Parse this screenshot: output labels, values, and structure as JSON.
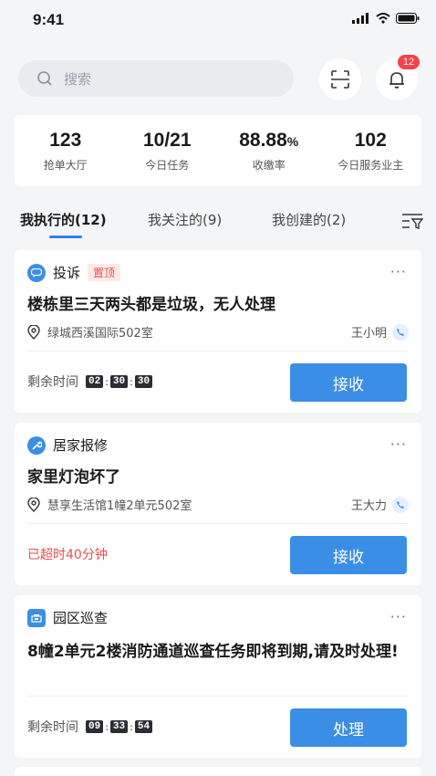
{
  "status_bar": {
    "time": "9:41"
  },
  "search": {
    "placeholder": "搜索"
  },
  "notifications": {
    "count": "12"
  },
  "stats": [
    {
      "value": "123",
      "unit": "",
      "label": "抢单大厅"
    },
    {
      "value": "10/21",
      "unit": "",
      "label": "今日任务"
    },
    {
      "value": "88.88",
      "unit": "%",
      "label": "收缴率"
    },
    {
      "value": "102",
      "unit": "",
      "label": "今日服务业主"
    }
  ],
  "tabs": [
    {
      "label": "我执行的(12)",
      "active": true
    },
    {
      "label": "我关注的(9)",
      "active": false
    },
    {
      "label": "我创建的(2)",
      "active": false
    }
  ],
  "cards": [
    {
      "type": "投诉",
      "tag": "置顶",
      "more": "···",
      "title": "楼栋里三天两头都是垃圾，无人处理",
      "address": "绿城西溪国际502室",
      "person": "王小明",
      "status_label": "剩余时间",
      "timer": [
        "02",
        "30",
        "30"
      ],
      "action": "接收"
    },
    {
      "type": "居家报修",
      "more": "···",
      "title": "家里灯泡坏了",
      "address": "慧享生活馆1幢2单元502室",
      "person": "王大力",
      "status_label": "已超时40分钟",
      "action": "接收"
    },
    {
      "type": "园区巡查",
      "more": "···",
      "title": "8幢2单元2楼消防通道巡查任务即将到期,请及时处理!",
      "status_label": "剩余时间",
      "timer": [
        "09",
        "33",
        "54"
      ],
      "action": "处理"
    }
  ]
}
